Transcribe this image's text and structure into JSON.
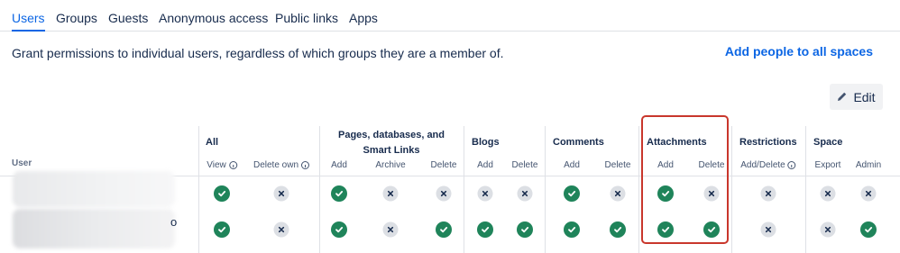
{
  "tabs": [
    {
      "label": "Users",
      "active": true
    },
    {
      "label": "Groups",
      "active": false
    },
    {
      "label": "Guests",
      "active": false
    },
    {
      "label": "Anonymous access",
      "active": false
    },
    {
      "label": "Public links",
      "active": false
    },
    {
      "label": "Apps",
      "active": false
    }
  ],
  "description": "Grant permissions to individual users, regardless of which groups they are a member of.",
  "add_people_link": "Add people to all spaces",
  "edit_button": "Edit",
  "table": {
    "user_header": "User",
    "groups": [
      {
        "label": "All"
      },
      {
        "label": "Pages, databases, and Smart Links"
      },
      {
        "label": "Blogs"
      },
      {
        "label": "Comments"
      },
      {
        "label": "Attachments",
        "highlighted": true
      },
      {
        "label": "Restrictions"
      },
      {
        "label": "Space"
      }
    ],
    "columns": [
      {
        "label": "View",
        "info": true
      },
      {
        "label": "Delete own",
        "info": true
      },
      {
        "label": "Add"
      },
      {
        "label": "Archive"
      },
      {
        "label": "Delete"
      },
      {
        "label": "Add"
      },
      {
        "label": "Delete"
      },
      {
        "label": "Add"
      },
      {
        "label": "Delete"
      },
      {
        "label": "Add"
      },
      {
        "label": "Delete"
      },
      {
        "label": "Add/Delete",
        "info": true
      },
      {
        "label": "Export"
      },
      {
        "label": "Admin"
      }
    ],
    "rows": [
      {
        "user": "",
        "permissions": [
          true,
          false,
          true,
          false,
          false,
          false,
          false,
          true,
          false,
          true,
          false,
          false,
          false,
          false
        ]
      },
      {
        "user": "o",
        "permissions": [
          true,
          false,
          true,
          false,
          true,
          true,
          true,
          true,
          true,
          true,
          true,
          false,
          false,
          true
        ]
      }
    ]
  },
  "colors": {
    "accent": "#0c66e4",
    "granted": "#1f845a",
    "denied": "#dcdfe4",
    "highlight_border": "#c9372c"
  },
  "icons": {
    "granted": "check-circle-icon",
    "denied": "cross-circle-icon",
    "edit": "pencil-icon",
    "info": "info-icon"
  }
}
